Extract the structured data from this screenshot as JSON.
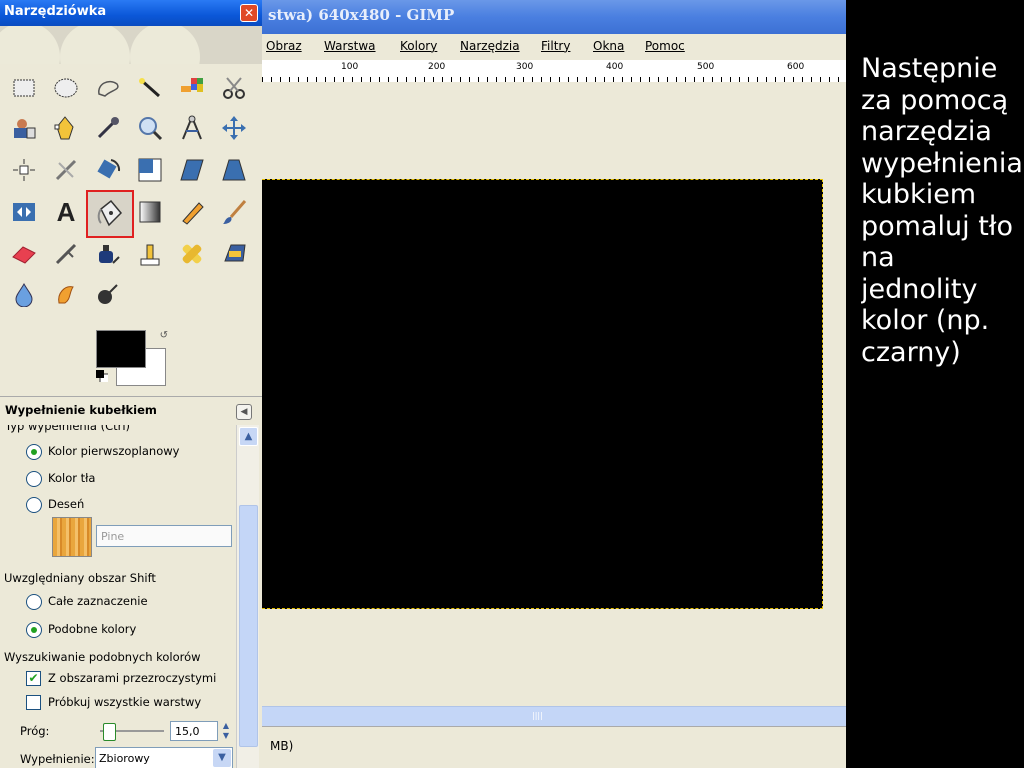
{
  "toolbox": {
    "title": "Narzędziówka",
    "close_icon": "close-icon",
    "tools": [
      "rect-select-icon",
      "ellipse-select-icon",
      "free-select-icon",
      "fuzzy-select-icon",
      "select-by-color-icon",
      "scissors-icon",
      "foreground-select-icon",
      "paths-icon",
      "color-picker-icon",
      "zoom-icon",
      "measure-icon",
      "move-icon",
      "align-icon",
      "crop-icon",
      "rotate-icon",
      "scale-icon",
      "shear-icon",
      "perspective-icon",
      "flip-icon",
      "text-icon",
      "bucket-fill-icon",
      "blend-icon",
      "pencil-icon",
      "paintbrush-icon",
      "eraser-icon",
      "airbrush-icon",
      "ink-icon",
      "clone-icon",
      "heal-icon",
      "perspective-clone-icon",
      "blur-icon",
      "smudge-icon",
      "dodge-burn-icon"
    ],
    "selected_tool": "bucket-fill-icon",
    "colors": {
      "foreground": "#000000",
      "background": "#ffffff"
    }
  },
  "options": {
    "title": "Wypełnienie kubełkiem",
    "fill_type_label": "Typ wypełnienia  (Ctrl)",
    "fill_types": [
      "Kolor pierwszoplanowy",
      "Kolor tła",
      "Deseń"
    ],
    "fill_type_selected": 0,
    "pattern_name": "Pine",
    "area_label": "Uwzględniany obszar  Shift",
    "areas": [
      "Całe zaznaczenie",
      "Podobne kolory"
    ],
    "area_selected": 1,
    "similar_label": "Wyszukiwanie podobnych kolorów",
    "checkboxes": [
      {
        "label": "Z obszarami przezroczystymi",
        "checked": true
      },
      {
        "label": "Próbkuj wszystkie warstwy",
        "checked": false
      }
    ],
    "threshold_label": "Próg:",
    "threshold_value": "15,0",
    "threshold_fraction": 0.06,
    "fill_mode_label": "Wypełnienie:",
    "fill_mode_value": "Zbiorowy"
  },
  "image_window": {
    "title": "stwa) 640x480 - GIMP",
    "menu": [
      "Obraz",
      "Warstwa",
      "Kolory",
      "Narzędzia",
      "Filtry",
      "Okna",
      "Pomoc"
    ],
    "ruler_labels": [
      "100",
      "200",
      "300",
      "400",
      "500",
      "600"
    ],
    "status": "MB)",
    "selection_color": "#e6c000"
  },
  "note": {
    "lines": [
      "Następnie",
      "za pomocą",
      "narzędzia",
      "wypełnienia",
      "kubkiem",
      "pomaluj tło",
      "na",
      "jednolity",
      "kolor (np.",
      "czarny)"
    ]
  }
}
